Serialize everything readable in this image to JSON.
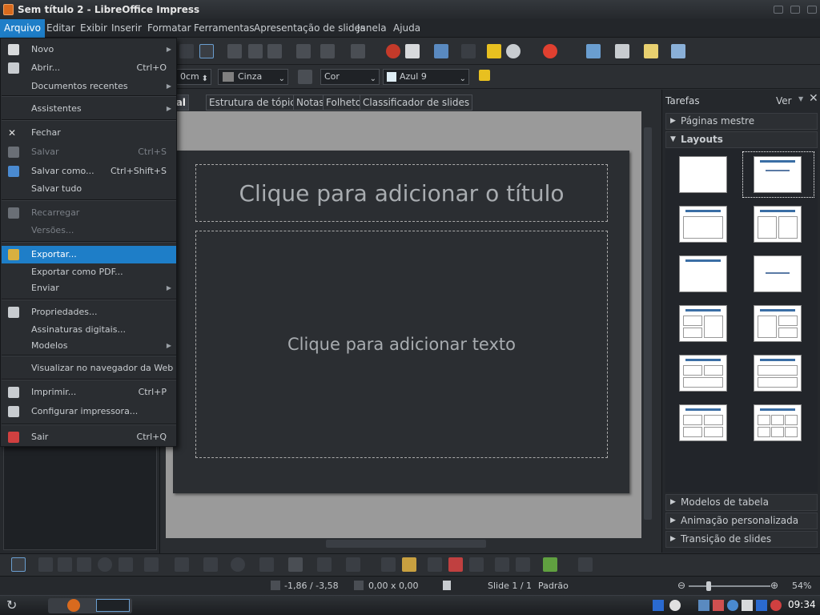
{
  "window": {
    "title": "Sem título 2 - LibreOffice Impress"
  },
  "menubar": [
    "Arquivo",
    "Editar",
    "Exibir",
    "Inserir",
    "Formatar",
    "Ferramentas",
    "Apresentação de slides",
    "Janela",
    "Ajuda"
  ],
  "file_menu": {
    "items": [
      {
        "label": "Novo",
        "shortcut": "",
        "submenu": true,
        "disabled": false,
        "highlight": false,
        "icon": "new-document-icon"
      },
      {
        "label": "Abrir...",
        "shortcut": "Ctrl+O",
        "submenu": false,
        "disabled": false,
        "highlight": false,
        "icon": "open-folder-icon"
      },
      {
        "label": "Documentos recentes",
        "shortcut": "",
        "submenu": true,
        "disabled": false,
        "highlight": false,
        "icon": ""
      },
      {
        "label": "Assistentes",
        "shortcut": "",
        "submenu": true,
        "disabled": false,
        "highlight": false,
        "icon": ""
      },
      {
        "label": "Fechar",
        "shortcut": "",
        "submenu": false,
        "disabled": false,
        "highlight": false,
        "icon": "close-icon"
      },
      {
        "label": "Salvar",
        "shortcut": "Ctrl+S",
        "submenu": false,
        "disabled": true,
        "highlight": false,
        "icon": "save-icon"
      },
      {
        "label": "Salvar como...",
        "shortcut": "Ctrl+Shift+S",
        "submenu": false,
        "disabled": false,
        "highlight": false,
        "icon": "save-as-icon"
      },
      {
        "label": "Salvar tudo",
        "shortcut": "",
        "submenu": false,
        "disabled": false,
        "highlight": false,
        "icon": ""
      },
      {
        "label": "Recarregar",
        "shortcut": "",
        "submenu": false,
        "disabled": true,
        "highlight": false,
        "icon": "reload-icon"
      },
      {
        "label": "Versões...",
        "shortcut": "",
        "submenu": false,
        "disabled": true,
        "highlight": false,
        "icon": ""
      },
      {
        "label": "Exportar...",
        "shortcut": "",
        "submenu": false,
        "disabled": false,
        "highlight": true,
        "icon": "export-icon"
      },
      {
        "label": "Exportar como PDF...",
        "shortcut": "",
        "submenu": false,
        "disabled": false,
        "highlight": false,
        "icon": ""
      },
      {
        "label": "Enviar",
        "shortcut": "",
        "submenu": true,
        "disabled": false,
        "highlight": false,
        "icon": ""
      },
      {
        "label": "Propriedades...",
        "shortcut": "",
        "submenu": false,
        "disabled": false,
        "highlight": false,
        "icon": "properties-icon"
      },
      {
        "label": "Assinaturas digitais...",
        "shortcut": "",
        "submenu": false,
        "disabled": false,
        "highlight": false,
        "icon": ""
      },
      {
        "label": "Modelos",
        "shortcut": "",
        "submenu": true,
        "disabled": false,
        "highlight": false,
        "icon": ""
      },
      {
        "label": "Visualizar no navegador da Web",
        "shortcut": "",
        "submenu": false,
        "disabled": false,
        "highlight": false,
        "icon": ""
      },
      {
        "label": "Imprimir...",
        "shortcut": "Ctrl+P",
        "submenu": false,
        "disabled": false,
        "highlight": false,
        "icon": "print-icon"
      },
      {
        "label": "Configurar impressora...",
        "shortcut": "",
        "submenu": false,
        "disabled": false,
        "highlight": false,
        "icon": "printer-setup-icon"
      },
      {
        "label": "Sair",
        "shortcut": "Ctrl+Q",
        "submenu": false,
        "disabled": false,
        "highlight": false,
        "icon": "exit-icon"
      }
    ]
  },
  "formatbar": {
    "width_value": "0cm",
    "line_color": "Cinza",
    "area_style": "Cor",
    "area_color": "Azul 9"
  },
  "view_tabs": [
    "Normal",
    "Estrutura de tópicos",
    "Notas",
    "Folheto",
    "Classificador de slides"
  ],
  "slide": {
    "title_placeholder": "Clique para adicionar o título",
    "text_placeholder": "Clique para adicionar texto"
  },
  "tasks": {
    "title": "Tarefas",
    "view_label": "Ver",
    "sections": [
      "Páginas mestre",
      "Layouts",
      "Modelos de tabela",
      "Animação personalizada",
      "Transição de slides"
    ]
  },
  "status": {
    "position": "-1,86 / -3,58",
    "size": "0,00 x 0,00",
    "slide": "Slide 1 / 1",
    "master": "Padrão",
    "zoom": "54%"
  },
  "taskbar": {
    "clock": "09:34"
  },
  "colors": {
    "accent": "#1e7ec8",
    "menu_bg": "#2a2d31",
    "window_bg": "#23262a"
  }
}
